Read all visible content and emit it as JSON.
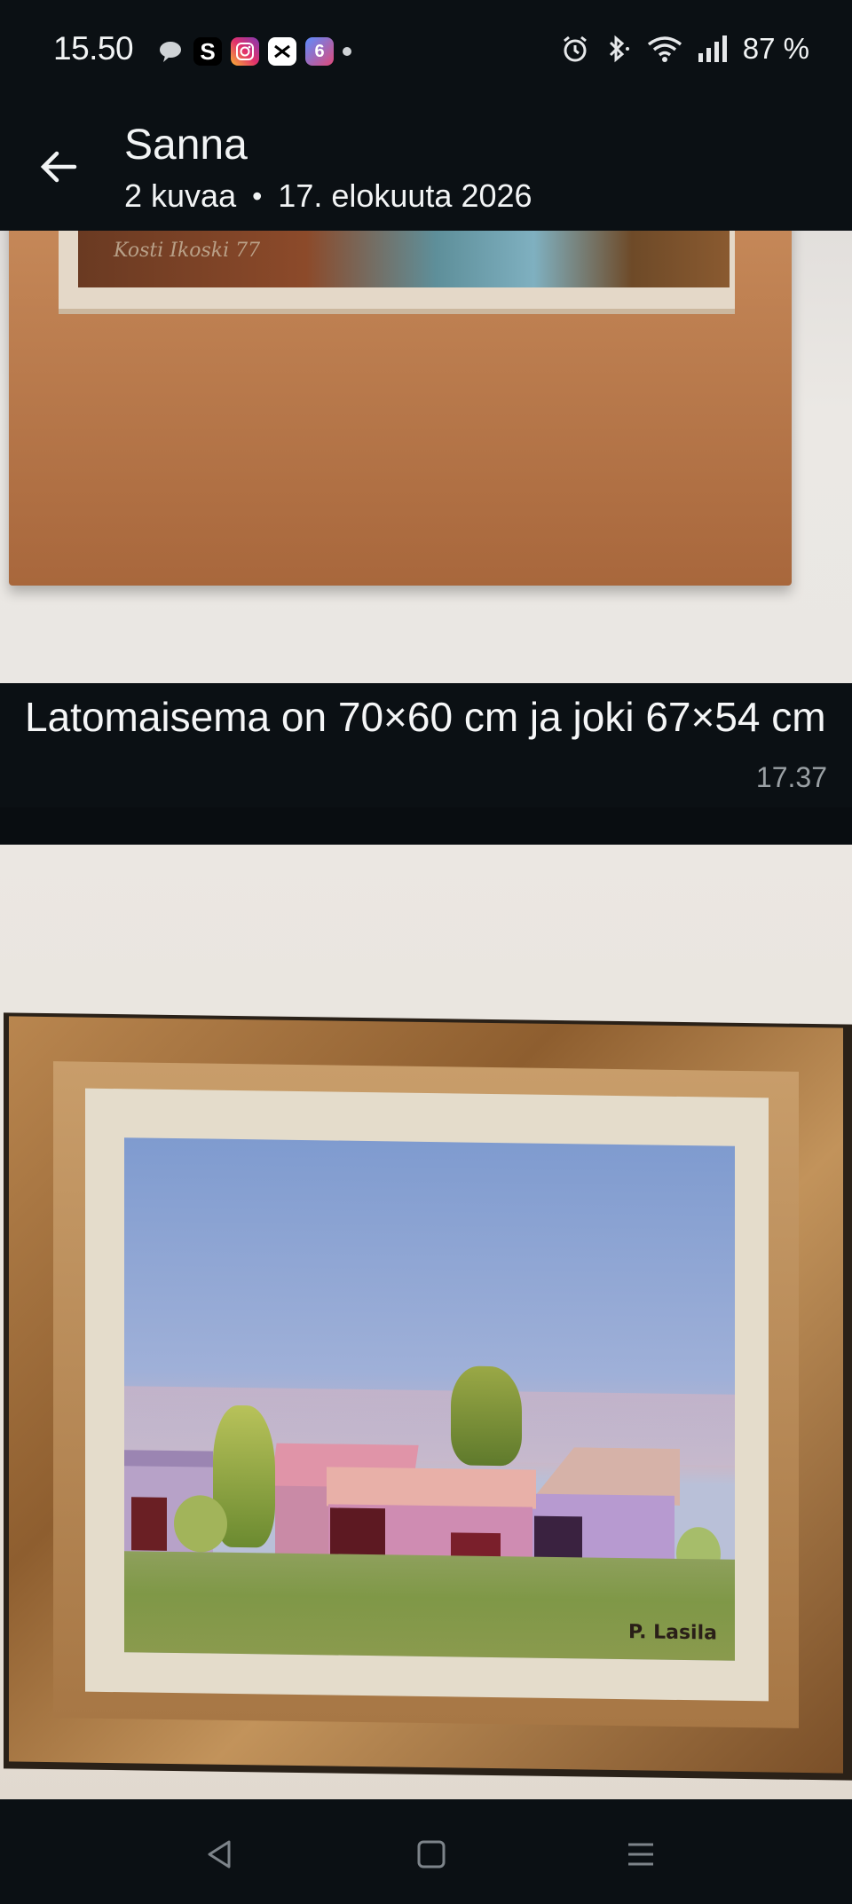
{
  "status_bar": {
    "time": "15.50",
    "notification_icons": [
      "chat-bubble-icon",
      "s-app-icon",
      "instagram-icon",
      "capcut-icon",
      "six-app-icon",
      "more-dot-icon"
    ],
    "s_app_letter": "S",
    "six_app_label": "6",
    "system_icons": [
      "alarm-icon",
      "bluetooth-icon",
      "wifi-icon",
      "signal-icon"
    ],
    "battery": "87 %"
  },
  "app_bar": {
    "title": "Sanna",
    "subtitle_count": "2 kuvaa",
    "subtitle_separator": "•",
    "subtitle_date": "17. elokuuta 2026"
  },
  "message": {
    "caption": "Latomaisema on 70×60 cm ja joki 67×54 cm",
    "time": "17.37"
  },
  "photos": [
    {
      "signature": "Kosti Ikoski 77"
    },
    {
      "signature": "P. Lasila"
    }
  ],
  "colors": {
    "background": "#0b1014",
    "text": "#f2f4f5",
    "muted": "#9aa0a4"
  }
}
